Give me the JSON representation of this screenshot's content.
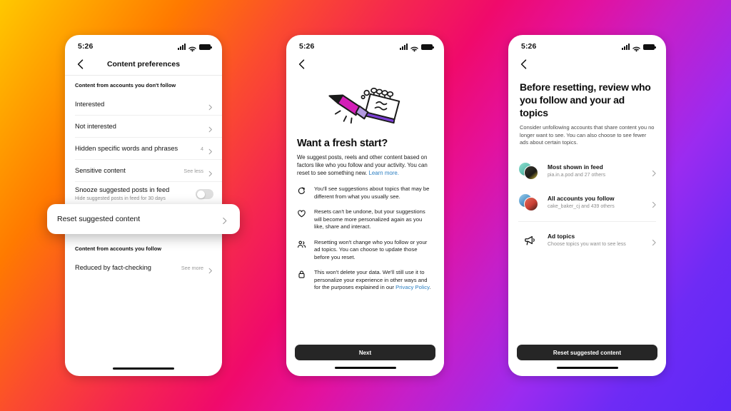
{
  "background": {
    "gradient_colors": [
      "#FFC800",
      "#FF7A00",
      "#F5284E",
      "#F00A6B",
      "#C51FC9",
      "#6E2BF5"
    ]
  },
  "shared": {
    "status": {
      "time": "5:26",
      "signal_icon": "signal-bars-icon",
      "wifi_icon": "wifi-icon",
      "battery_icon": "battery-full-icon"
    },
    "back_icon": "back-chevron-icon",
    "chevron_icon": "chevron-right-icon"
  },
  "phone1": {
    "nav_title": "Content preferences",
    "section1_header": "Content from accounts you don't follow",
    "rows": [
      {
        "title": "Interested",
        "aside": "",
        "type": "chevron"
      },
      {
        "title": "Not interested",
        "aside": "",
        "type": "chevron"
      },
      {
        "title": "Hidden specific words and phrases",
        "aside": "4",
        "type": "chevron"
      },
      {
        "title": "Sensitive content",
        "aside": "See less",
        "type": "chevron"
      }
    ],
    "snooze": {
      "title": "Snooze suggested posts in feed",
      "subtitle": "Hide suggested posts in feed for 30 days",
      "toggle_state": "off"
    },
    "highlight": {
      "title": "Reset suggested content"
    },
    "section2_header": "Content from accounts you follow",
    "rows2": [
      {
        "title": "Reduced by fact-checking",
        "aside": "See more",
        "type": "chevron"
      }
    ]
  },
  "phone2": {
    "illustration": "pencil-erasing-notebook-illustration",
    "heading": "Want a fresh start?",
    "paragraph_text": "We suggest posts, reels and other content based on factors like who you follow and your activity. You can reset to see something new. ",
    "paragraph_link": "Learn more.",
    "bullets": [
      {
        "icon": "refresh-arrow-icon",
        "text": "You'll see suggestions about topics that may be different from what you usually see."
      },
      {
        "icon": "heart-icon",
        "text": "Resets can't be undone, but your suggestions will become more personalized again as you like, share and interact."
      },
      {
        "icon": "people-icon",
        "text": "Resetting won't change who you follow or your ad topics. You can choose to update those before you reset."
      },
      {
        "icon": "lock-icon",
        "text_before": "This won't delete your data. We'll still use it to personalize your experience in other ways and for the purposes explained in our ",
        "link": "Privacy Policy",
        "text_after": "."
      }
    ],
    "cta_label": "Next"
  },
  "phone3": {
    "heading": "Before resetting, review who you follow and your ad topics",
    "paragraph": "Consider unfollowing accounts that share content you no longer want to see. You can also choose to see fewer ads about certain topics.",
    "rows": [
      {
        "icon": "avatar-stack",
        "title": "Most shown in feed",
        "subtitle": "pia.in.a.pod and 27 others",
        "avatar_a": "#7fd4c8",
        "avatar_b": "#1f1c17"
      },
      {
        "icon": "avatar-stack",
        "title": "All accounts you follow",
        "subtitle": "cake_baker_cj and 439 others",
        "avatar_a": "#5aa4d4",
        "avatar_b": "#d4493f"
      },
      {
        "icon": "megaphone-icon",
        "title": "Ad topics",
        "subtitle": "Choose topics you want to see less"
      }
    ],
    "cta_label": "Reset suggested content"
  }
}
